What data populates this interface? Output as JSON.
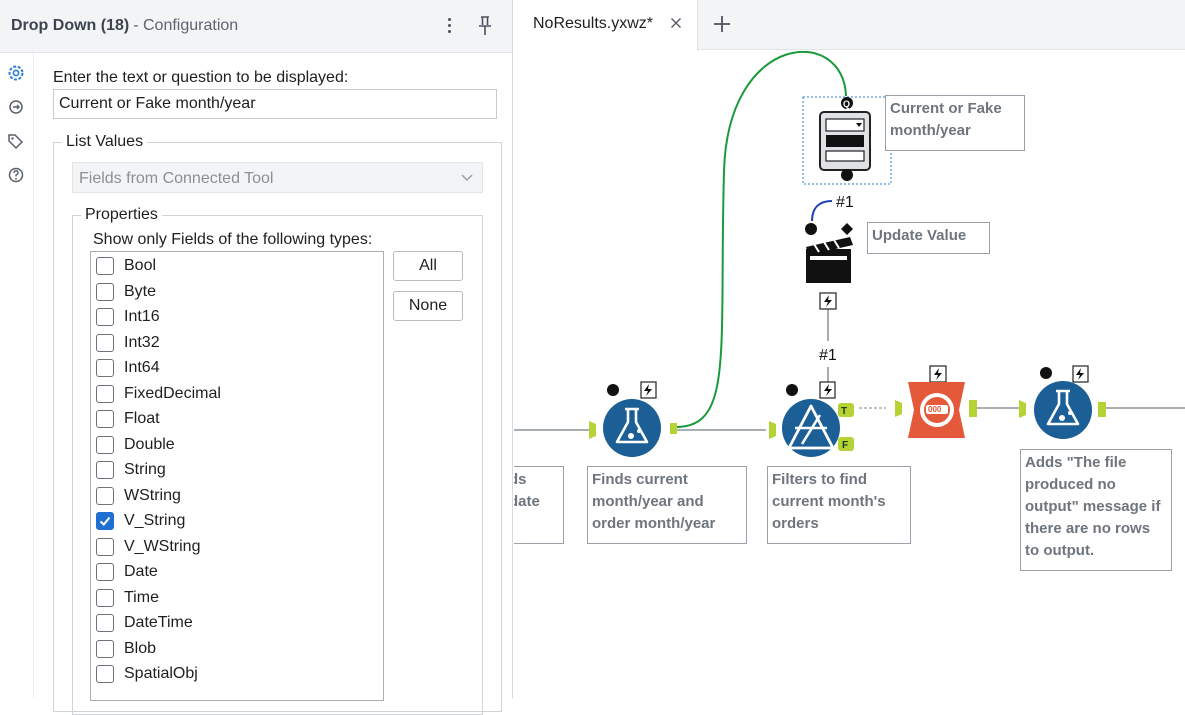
{
  "config": {
    "tool_name": "Drop Down (18)",
    "subtitle": "- Configuration",
    "side_icons": [
      "gear-icon",
      "connection-icon",
      "tag-icon",
      "help-icon"
    ],
    "question_label": "Enter the text or question to be displayed:",
    "question_value": "Current or Fake month/year",
    "list_values_legend": "List Values",
    "source_select": "Fields from Connected Tool",
    "properties_legend": "Properties",
    "types_label": "Show only Fields of the following types:",
    "types": [
      {
        "label": "Bool",
        "checked": false
      },
      {
        "label": "Byte",
        "checked": false
      },
      {
        "label": "Int16",
        "checked": false
      },
      {
        "label": "Int32",
        "checked": false
      },
      {
        "label": "Int64",
        "checked": false
      },
      {
        "label": "FixedDecimal",
        "checked": false
      },
      {
        "label": "Float",
        "checked": false
      },
      {
        "label": "Double",
        "checked": false
      },
      {
        "label": "String",
        "checked": false
      },
      {
        "label": "WString",
        "checked": false
      },
      {
        "label": "V_String",
        "checked": true
      },
      {
        "label": "V_WString",
        "checked": false
      },
      {
        "label": "Date",
        "checked": false
      },
      {
        "label": "Time",
        "checked": false
      },
      {
        "label": "DateTime",
        "checked": false
      },
      {
        "label": "Blob",
        "checked": false
      },
      {
        "label": "SpatialObj",
        "checked": false
      }
    ],
    "all_button": "All",
    "none_button": "None"
  },
  "tabs": {
    "doc_tab": "NoResults.yxwz*",
    "close_icon": "close-icon",
    "new_tab_icon": "plus-icon"
  },
  "canvas": {
    "connection_labels": {
      "upper": "#1",
      "lower": "#1"
    },
    "anchor_letters": {
      "question": "Q",
      "true": "T",
      "false": "F"
    },
    "annotations": {
      "dropdown": "Current or Fake month/year",
      "update_value": "Update Value",
      "partial": "ds\ndate",
      "formula1": "Finds current month/year and order month/year",
      "filter": "Filters to find current month's orders",
      "formula2": "Adds \"The file produced no output\" message if there are no rows to output."
    },
    "colors": {
      "tool_blue": "#1b5f96",
      "tool_orange": "#e5593b",
      "connection_green": "#1a9a3a",
      "anchor_green": "#b5d334",
      "connection_gray": "#a9aeb3"
    }
  }
}
